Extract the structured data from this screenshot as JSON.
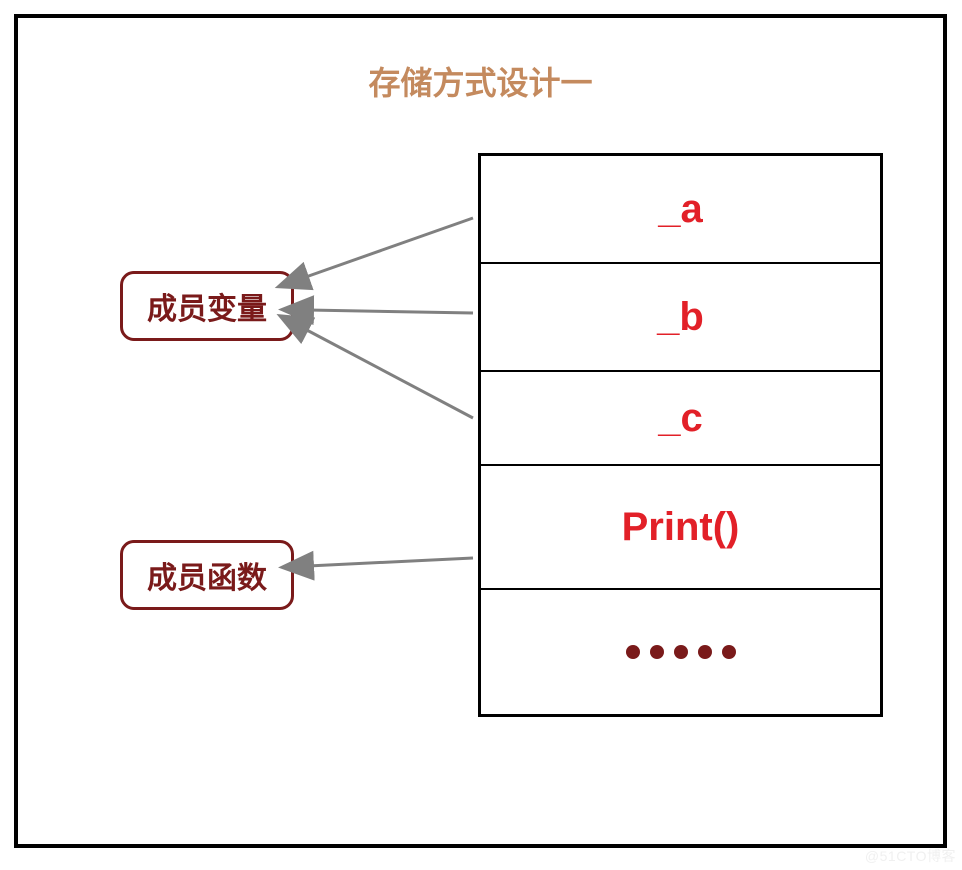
{
  "title": "存储方式设计一",
  "labels": {
    "member_var": "成员变量",
    "member_func": "成员函数"
  },
  "class_cells": {
    "a": "_a",
    "b": "_b",
    "c": "_c",
    "print": "Print()"
  },
  "watermark": "@51CTO博客",
  "colors": {
    "title": "#c48a5e",
    "label_border": "#7a1a1a",
    "cell_text": "#e22028",
    "arrow": "#808080"
  }
}
